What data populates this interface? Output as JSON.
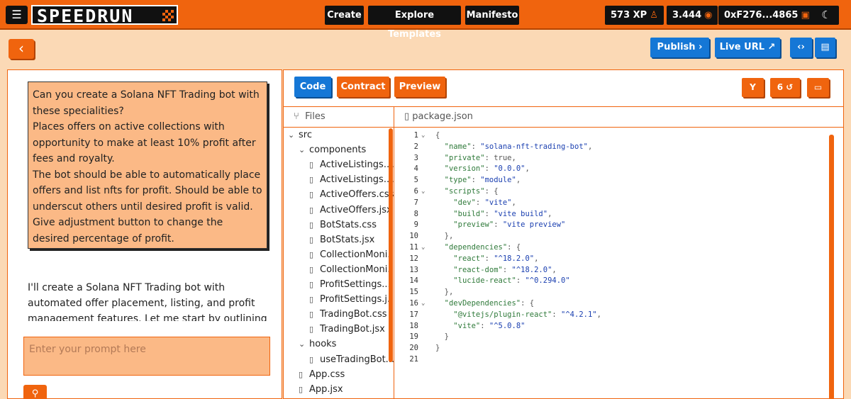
{
  "topbar": {
    "menu_icon": "☰",
    "logo": "SPEEDRUN",
    "nav": [
      "Create",
      "Explore Templates",
      "Manifesto"
    ],
    "xp": "573 XP",
    "xp_icon": "♙",
    "balance": "3.444",
    "balance_icon": "◉",
    "wallet": "0xF276...4865",
    "wallet_icon": "▣",
    "theme_icon": "☾"
  },
  "toolbar": {
    "back_icon": "‹",
    "publish": "Publish ›",
    "live_url": "Live URL ↗",
    "code_icon": "‹›",
    "chat_icon": "▤"
  },
  "chat": {
    "user_message": [
      "Can you create a Solana NFT Trading bot with these specialities?",
      "Places offers on active collections with opportunity to make at least 10% profit after fees and royalty.",
      "The bot should be able to automatically place offers and list nfts for profit. Should be able to underscut others until desired profit is valid.",
      "Give adjustment button to change the desired percentage of profit."
    ],
    "ai_message": "I'll create a Solana NFT Trading bot with automated offer placement, listing, and profit management features. Let me start by outlining",
    "prompt_placeholder": "Enter your prompt here",
    "attach_icon": "⚲"
  },
  "editor": {
    "tabs": [
      "Code",
      "Contract",
      "Preview"
    ],
    "branch_icon": "Y",
    "history": "6 ↺",
    "terminal_icon": "▭",
    "files_label": "Files",
    "files_icon": "⑂",
    "open_file": "package.json",
    "file_icon": "▯",
    "tree": [
      {
        "name": "src",
        "type": "folder",
        "depth": 0
      },
      {
        "name": "components",
        "type": "folder",
        "depth": 1
      },
      {
        "name": "ActiveListings....",
        "type": "file",
        "depth": 2
      },
      {
        "name": "ActiveListings....",
        "type": "file",
        "depth": 2
      },
      {
        "name": "ActiveOffers.css",
        "type": "file",
        "depth": 2
      },
      {
        "name": "ActiveOffers.jsx",
        "type": "file",
        "depth": 2
      },
      {
        "name": "BotStats.css",
        "type": "file",
        "depth": 2
      },
      {
        "name": "BotStats.jsx",
        "type": "file",
        "depth": 2
      },
      {
        "name": "CollectionMoni...",
        "type": "file",
        "depth": 2
      },
      {
        "name": "CollectionMoni...",
        "type": "file",
        "depth": 2
      },
      {
        "name": "ProfitSettings....",
        "type": "file",
        "depth": 2
      },
      {
        "name": "ProfitSettings.j...",
        "type": "file",
        "depth": 2
      },
      {
        "name": "TradingBot.css",
        "type": "file",
        "depth": 2
      },
      {
        "name": "TradingBot.jsx",
        "type": "file",
        "depth": 2
      },
      {
        "name": "hooks",
        "type": "folder",
        "depth": 1
      },
      {
        "name": "useTradingBot....",
        "type": "file",
        "depth": 2
      },
      {
        "name": "App.css",
        "type": "file",
        "depth": 1
      },
      {
        "name": "App.jsx",
        "type": "file",
        "depth": 1
      }
    ],
    "code_lines": [
      {
        "n": "1",
        "fold": true,
        "text": "{"
      },
      {
        "n": "2",
        "fold": false,
        "text": "  \"name\": \"solana-nft-trading-bot\","
      },
      {
        "n": "3",
        "fold": false,
        "text": "  \"private\": true,"
      },
      {
        "n": "4",
        "fold": false,
        "text": "  \"version\": \"0.0.0\","
      },
      {
        "n": "5",
        "fold": false,
        "text": "  \"type\": \"module\","
      },
      {
        "n": "6",
        "fold": true,
        "text": "  \"scripts\": {"
      },
      {
        "n": "7",
        "fold": false,
        "text": "    \"dev\": \"vite\","
      },
      {
        "n": "8",
        "fold": false,
        "text": "    \"build\": \"vite build\","
      },
      {
        "n": "9",
        "fold": false,
        "text": "    \"preview\": \"vite preview\""
      },
      {
        "n": "10",
        "fold": false,
        "text": "  },"
      },
      {
        "n": "11",
        "fold": true,
        "text": "  \"dependencies\": {"
      },
      {
        "n": "12",
        "fold": false,
        "text": "    \"react\": \"^18.2.0\","
      },
      {
        "n": "13",
        "fold": false,
        "text": "    \"react-dom\": \"^18.2.0\","
      },
      {
        "n": "14",
        "fold": false,
        "text": "    \"lucide-react\": \"^0.294.0\""
      },
      {
        "n": "15",
        "fold": false,
        "text": "  },"
      },
      {
        "n": "16",
        "fold": true,
        "text": "  \"devDependencies\": {"
      },
      {
        "n": "17",
        "fold": false,
        "text": "    \"@vitejs/plugin-react\": \"^4.2.1\","
      },
      {
        "n": "18",
        "fold": false,
        "text": "    \"vite\": \"^5.0.8\""
      },
      {
        "n": "19",
        "fold": false,
        "text": "  }"
      },
      {
        "n": "20",
        "fold": false,
        "text": "}"
      },
      {
        "n": "21",
        "fold": false,
        "text": ""
      }
    ]
  },
  "colors": {
    "brand_orange": "#f0640e",
    "accent_blue": "#1577d6",
    "panel_bg": "#fbd9b5",
    "message_bg": "#fbb986",
    "json_string": "#1a3fb0"
  }
}
